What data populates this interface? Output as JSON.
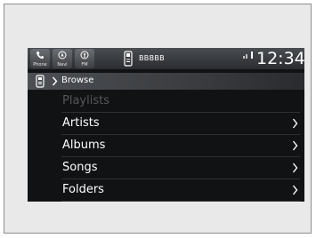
{
  "status_bar": {
    "buttons": [
      {
        "label": "Phone",
        "icon": "phone-icon"
      },
      {
        "label": "Navi",
        "icon": "navi-icon"
      },
      {
        "label": "FM",
        "icon": "radio-icon"
      }
    ],
    "source_icon": "usb-icon",
    "source_title": "BBBBB",
    "signal_icon": "signal-icon",
    "clock": "12:34"
  },
  "browse": {
    "source_icon": "usb-icon",
    "label": "Browse"
  },
  "list": {
    "items": [
      {
        "label": "Playlists",
        "enabled": false,
        "has_arrow": false
      },
      {
        "label": "Artists",
        "enabled": true,
        "has_arrow": true
      },
      {
        "label": "Albums",
        "enabled": true,
        "has_arrow": true
      },
      {
        "label": "Songs",
        "enabled": true,
        "has_arrow": true
      },
      {
        "label": "Folders",
        "enabled": true,
        "has_arrow": true
      }
    ]
  },
  "colors": {
    "screen_bg": "#111214",
    "text": "#ffffff",
    "disabled_text": "#55575a"
  }
}
